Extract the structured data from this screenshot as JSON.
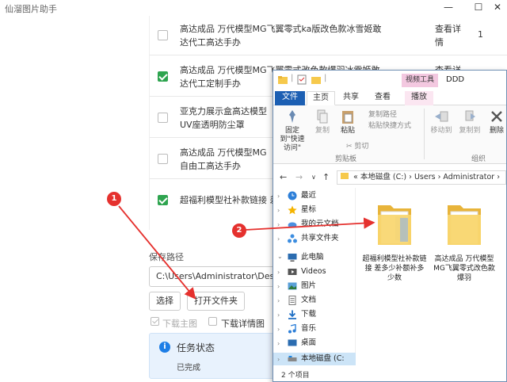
{
  "app": {
    "title": "仙溜图片助手",
    "minimize": "—",
    "maximize": "☐",
    "close": "✕"
  },
  "products": [
    {
      "title": "高达成品 万代模型MG飞翼零式ka版改色款冰雪姬敢达代工高达手办",
      "checked": false,
      "link": "查看详情",
      "count": "1"
    },
    {
      "title": "高达成品 万代模型MG飞翼零式改色款爆羽冰雪姬敢达代工定制手办",
      "checked": true,
      "link": "查看详情",
      "count": ""
    },
    {
      "title": "亚克力展示盒高达模型UV座透明防尘罩",
      "checked": false,
      "link": "",
      "count": ""
    },
    {
      "title": "高达成品 万代模型MG自由工高达手办",
      "checked": false,
      "link": "",
      "count": ""
    },
    {
      "title": "超福利模型社补款链接 差多少补多少数",
      "checked": true,
      "link": "",
      "count": ""
    }
  ],
  "save": {
    "label": "保存路径",
    "path": "C:\\Users\\Administrator\\Deskto",
    "choose_button": "选择",
    "open_button": "打开文件夹"
  },
  "options": {
    "download_main": "下载主图",
    "download_main_checked": true,
    "download_detail": "下载详情图",
    "download_detail_checked": false
  },
  "status": {
    "title": "任务状态",
    "text": "已完成"
  },
  "explorer": {
    "tools_tab": "视频工具",
    "title": "DDD",
    "tabs": [
      "文件",
      "主页",
      "共享",
      "查看",
      "播放"
    ],
    "ribbon": {
      "pin": "固定到\"快速访问\"",
      "copy": "复制",
      "paste": "粘贴",
      "copy_path": "复制路径",
      "paste_shortcut": "粘贴快捷方式",
      "cut": "剪切",
      "clipboard_group": "剪贴板",
      "move_to": "移动到",
      "copy_to": "复制到",
      "delete": "删除",
      "organize_group": "组织"
    },
    "address": {
      "chevrons": "«",
      "parts": "本地磁盘 (C:)  ›  Users  ›  Administrator  ›"
    },
    "nav": [
      {
        "label": "最近",
        "icon": "clock-icon"
      },
      {
        "label": "星标",
        "icon": "star-icon"
      },
      {
        "label": "我的云文档",
        "icon": "cloud-icon"
      },
      {
        "label": "共享文件夹",
        "icon": "share-icon"
      },
      {
        "label": "此电脑",
        "icon": "computer-icon"
      },
      {
        "label": "Videos",
        "icon": "video-icon"
      },
      {
        "label": "图片",
        "icon": "picture-icon"
      },
      {
        "label": "文档",
        "icon": "document-icon"
      },
      {
        "label": "下载",
        "icon": "download-icon"
      },
      {
        "label": "音乐",
        "icon": "music-icon"
      },
      {
        "label": "桌面",
        "icon": "desktop-icon"
      },
      {
        "label": "本地磁盘 (C:",
        "icon": "drive-icon"
      }
    ],
    "folders": [
      {
        "name": "超福利模型社补款链接 差多少补额补多少数"
      },
      {
        "name": "高达成品 万代模型MG飞翼零式改色款爆羽"
      }
    ],
    "status_bar": "2 个项目"
  },
  "annotations": {
    "badge_1": "1",
    "badge_2": "2",
    "color": "#e5312e"
  }
}
